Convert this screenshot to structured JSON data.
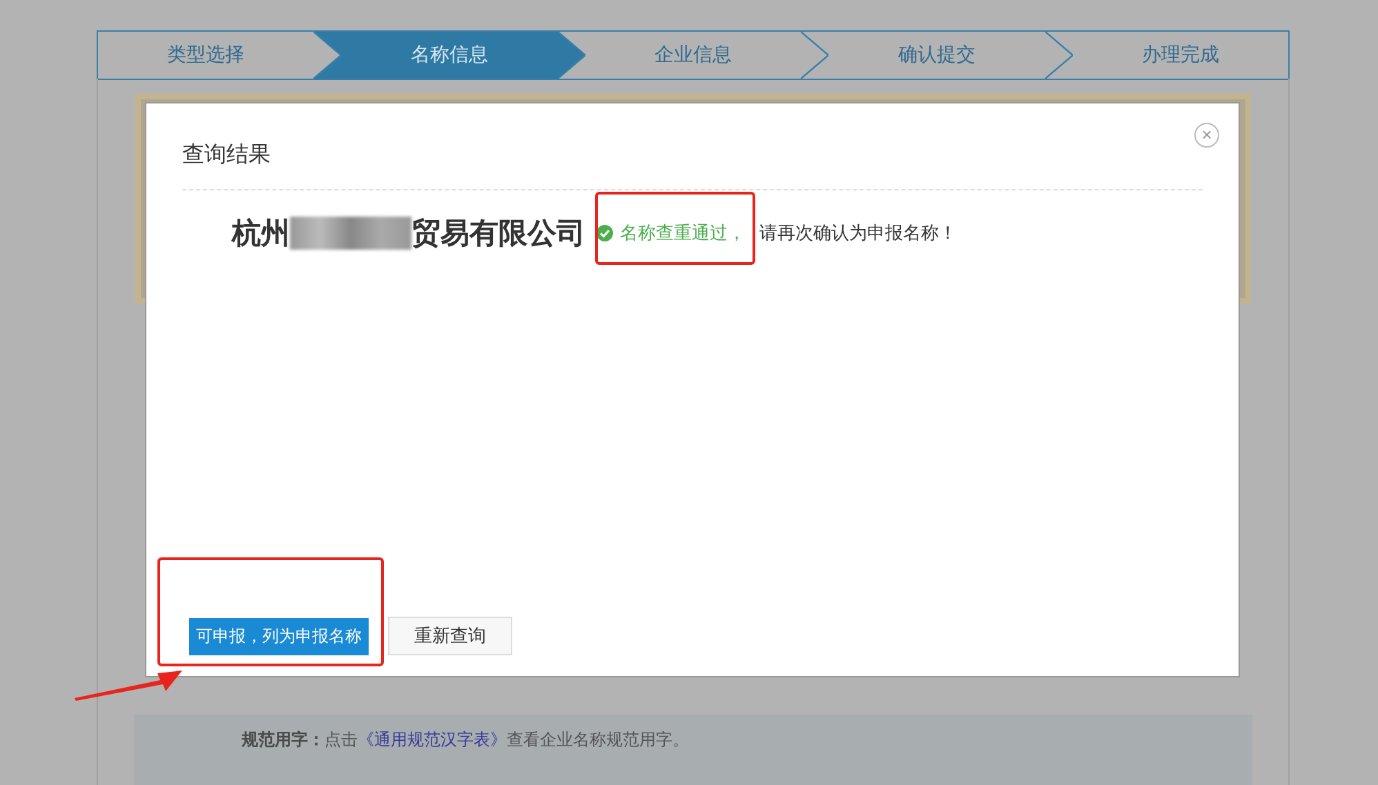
{
  "steps": [
    {
      "label": "类型选择",
      "selected": false
    },
    {
      "label": "名称信息",
      "selected": true
    },
    {
      "label": "企业信息",
      "selected": false
    },
    {
      "label": "确认提交",
      "selected": false
    },
    {
      "label": "办理完成",
      "selected": false
    }
  ],
  "dialog": {
    "title": "查询结果",
    "close": "×",
    "name_prefix": "杭州",
    "name_suffix": "贸易有限公司",
    "status": "名称查重通过",
    "status_punct": "，",
    "message": "请再次确认为申报名称！",
    "buttons": [
      {
        "label": "可申报，列为申报名称",
        "kind": "primary"
      },
      {
        "label": "重新查询",
        "kind": "secondary"
      }
    ]
  },
  "help": {
    "label": "规范用字：",
    "before": "点击",
    "link": "《通用规范汉字表》",
    "after": "查看企业名称规范用字。"
  }
}
